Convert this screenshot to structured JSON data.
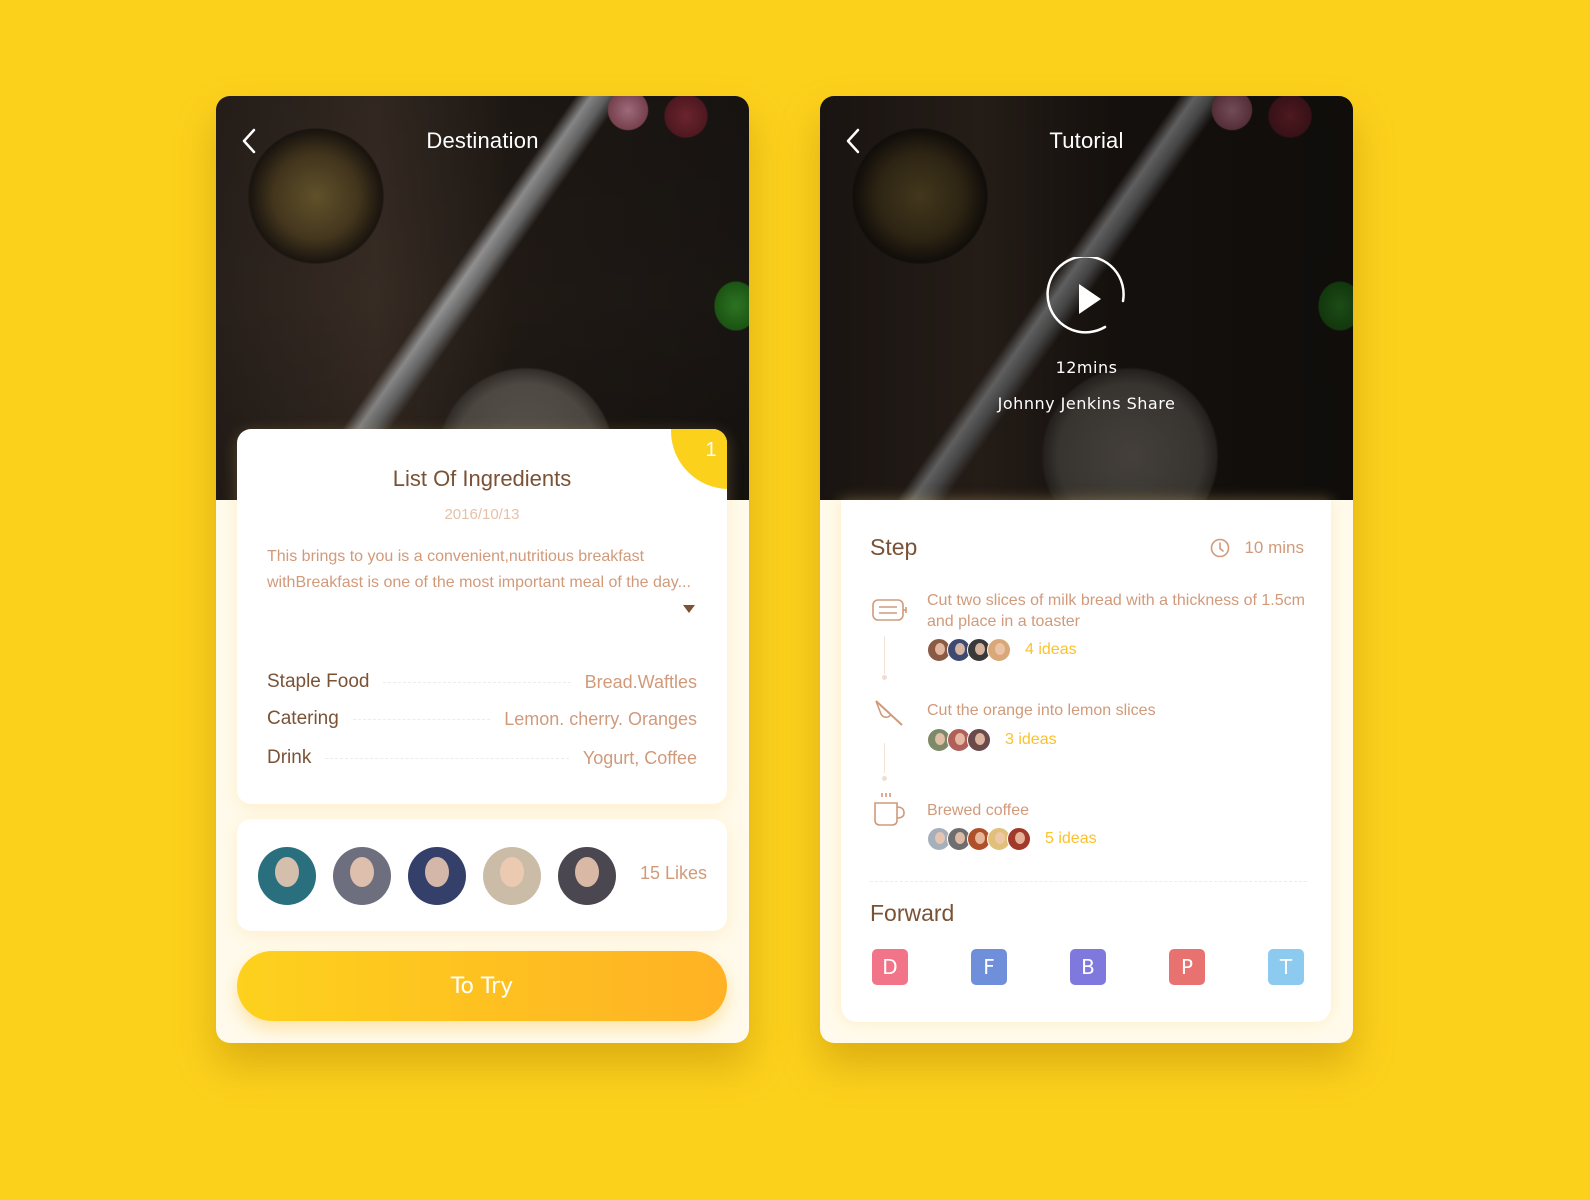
{
  "colors": {
    "background": "#fcd11c",
    "accent": "#fcd11c",
    "heading_text": "#7a5236",
    "body_text": "#d19a7a",
    "ideas_text": "#fcc12c"
  },
  "left_screen": {
    "title": "Destination",
    "back_icon": "chevron-left-icon",
    "card": {
      "badge": "1",
      "title": "List Of Ingredients",
      "date": "2016/10/13",
      "description": "This brings to you is a convenient,nutritious breakfast withBreakfast is one of the most important meal of the day...",
      "expand_icon": "caret-down-icon",
      "ingredients": [
        {
          "label": "Staple Food",
          "value": "Bread.Waftles"
        },
        {
          "label": "Catering",
          "value": "Lemon. cherry. Oranges"
        },
        {
          "label": "Drink",
          "value": "Yogurt,  Coffee"
        }
      ]
    },
    "likes": {
      "avatars": [
        "avatar-1",
        "avatar-2",
        "avatar-3",
        "avatar-4",
        "avatar-5"
      ],
      "avatar_colors": [
        "#2a6f7e",
        "#6d6f7e",
        "#34406a",
        "#cbbca8",
        "#4a4750"
      ],
      "count_label": "15 Likes"
    },
    "try_button": "To Try"
  },
  "right_screen": {
    "title": "Tutorial",
    "back_icon": "chevron-left-icon",
    "video": {
      "play_icon": "play-icon",
      "duration": "12mins",
      "author": "Johnny Jenkins Share"
    },
    "steps_section": {
      "title": "Step",
      "total_time": "10 mins",
      "clock_icon": "clock-icon",
      "steps": [
        {
          "icon": "toaster-icon",
          "text": "Cut two slices of milk bread with a thickness of 1.5cm and place in a toaster",
          "ideas": "4 ideas",
          "avatar_colors": [
            "#8a5a45",
            "#3e4a70",
            "#3a3a3a",
            "#d9a878"
          ]
        },
        {
          "icon": "knife-icon",
          "text": "Cut the orange into lemon slices",
          "ideas": "3 ideas",
          "avatar_colors": [
            "#7d8a6a",
            "#b0605a",
            "#6a4a4a"
          ]
        },
        {
          "icon": "coffee-cup-icon",
          "text": "Brewed coffee",
          "ideas": "5 ideas",
          "avatar_colors": [
            "#a6b0ba",
            "#6e6e6e",
            "#b0502a",
            "#e0c07a",
            "#a23a2a"
          ]
        }
      ]
    },
    "forward": {
      "title": "Forward",
      "buttons": [
        {
          "letter": "D",
          "color": "#f27488"
        },
        {
          "letter": "F",
          "color": "#6f8fdb"
        },
        {
          "letter": "B",
          "color": "#7f79dd"
        },
        {
          "letter": "P",
          "color": "#e87270"
        },
        {
          "letter": "T",
          "color": "#8ccbef"
        }
      ]
    }
  }
}
